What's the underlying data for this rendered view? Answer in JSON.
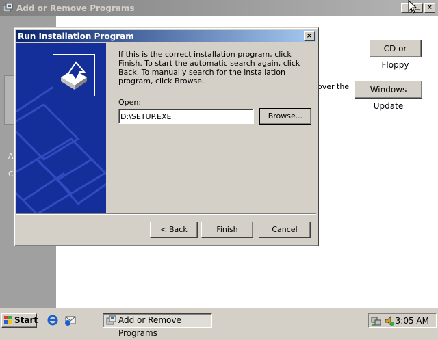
{
  "background_window": {
    "title": "Add or Remove Programs",
    "left_fragments": [
      "A",
      "C"
    ],
    "cd_floppy_button": "CD or Floppy",
    "cd_floppy_accel": "F",
    "over_the_text": "over the",
    "windows_update_button": "Windows Update"
  },
  "dialog": {
    "title": "Run Installation Program",
    "instructions": "If this is the correct installation program, click Finish. To start the automatic search again, click Back. To manually search for the installation program, click Browse.",
    "open_label": "Open:",
    "open_value": "D:\\SETUP.EXE",
    "browse_label": "Browse...",
    "back_label": "< Back",
    "finish_label": "Finish",
    "cancel_label": "Cancel"
  },
  "taskbar": {
    "start_label": "Start",
    "task_button_label": "Add or Remove Programs",
    "clock": "3:05 AM"
  },
  "colors": {
    "title_active": "#0a246a",
    "title_inactive": "#808080",
    "wizard_panel": "#142f9a",
    "face": "#d4d0c8"
  },
  "icons": {
    "app": "add-remove-programs-icon",
    "wizard_logo": "install-wizard-icon",
    "start": "windows-flag-icon",
    "quick_launch": [
      "internet-explorer-icon",
      "outlook-express-icon"
    ],
    "tray": [
      "network-icon",
      "volume-icon"
    ],
    "cursor": "mouse-pointer-icon"
  }
}
